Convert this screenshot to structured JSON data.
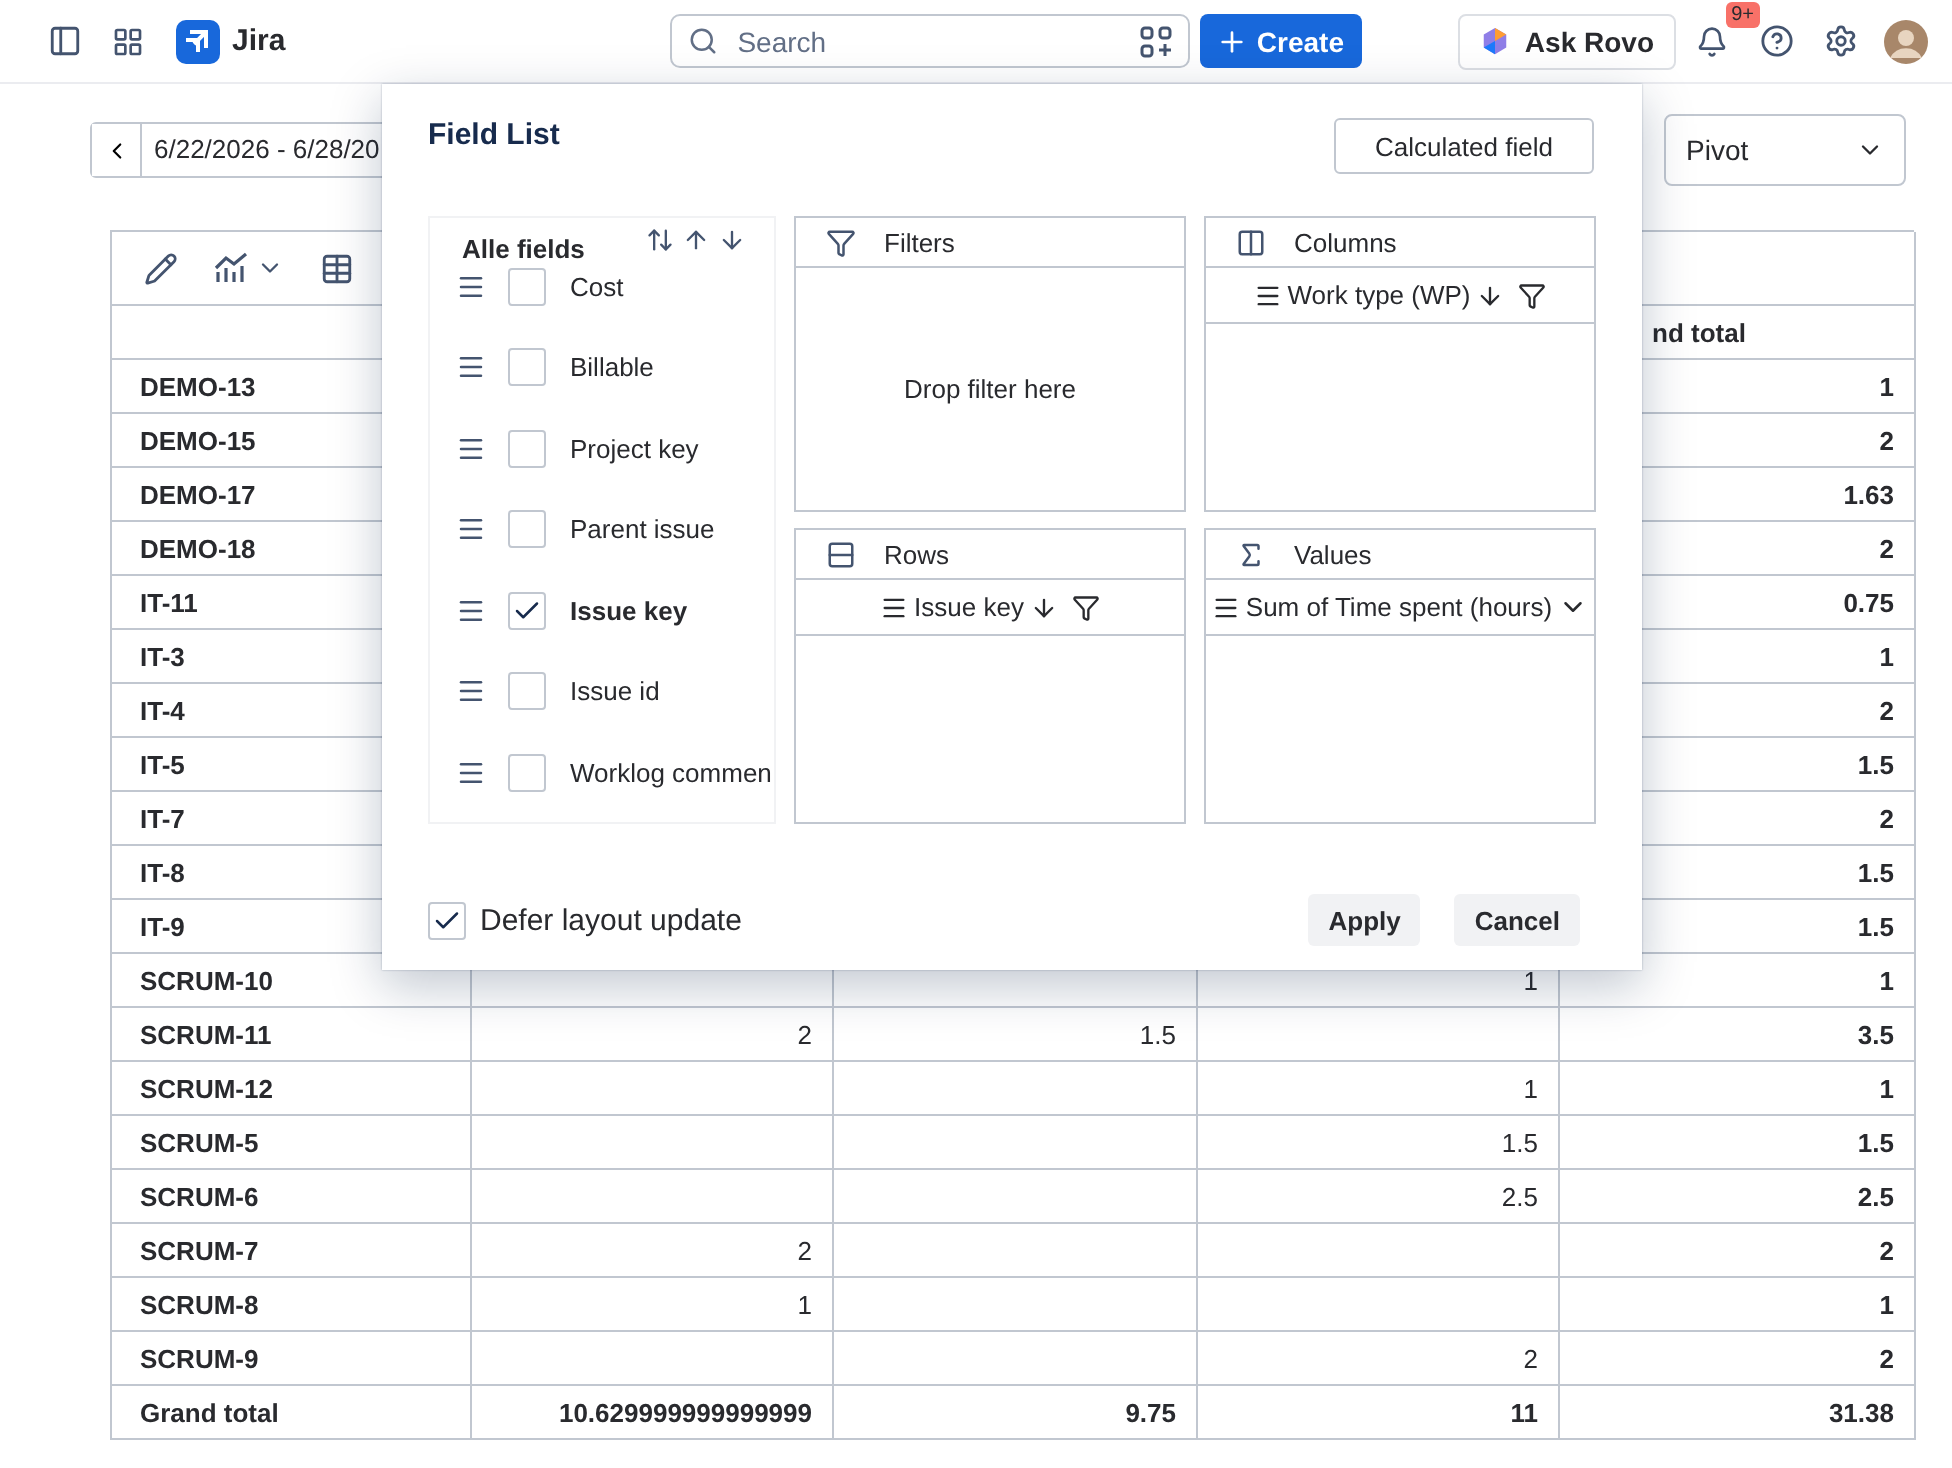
{
  "header": {
    "app_name": "Jira",
    "search_placeholder": "Search",
    "create_label": "Create",
    "ask_rovo": "Ask Rovo",
    "notification_badge": "9+"
  },
  "date_range": {
    "label": "6/22/2026 - 6/28/20"
  },
  "view_select": {
    "value": "Pivot"
  },
  "table": {
    "header_last": "nd total",
    "rows": [
      {
        "key": "DEMO-13",
        "cells": [
          null,
          null,
          null,
          "1"
        ]
      },
      {
        "key": "DEMO-15",
        "cells": [
          null,
          null,
          null,
          "2"
        ]
      },
      {
        "key": "DEMO-17",
        "cells": [
          null,
          null,
          null,
          "1.63"
        ]
      },
      {
        "key": "DEMO-18",
        "cells": [
          null,
          null,
          null,
          "2"
        ]
      },
      {
        "key": "IT-11",
        "cells": [
          null,
          null,
          null,
          "0.75"
        ]
      },
      {
        "key": "IT-3",
        "cells": [
          null,
          null,
          null,
          "1"
        ]
      },
      {
        "key": "IT-4",
        "cells": [
          null,
          null,
          null,
          "2"
        ]
      },
      {
        "key": "IT-5",
        "cells": [
          null,
          null,
          null,
          "1.5"
        ]
      },
      {
        "key": "IT-7",
        "cells": [
          null,
          null,
          null,
          "2"
        ]
      },
      {
        "key": "IT-8",
        "cells": [
          null,
          null,
          null,
          "1.5"
        ]
      },
      {
        "key": "IT-9",
        "cells": [
          null,
          null,
          null,
          "1.5"
        ]
      },
      {
        "key": "SCRUM-10",
        "cells": [
          null,
          null,
          "1",
          "1"
        ]
      },
      {
        "key": "SCRUM-11",
        "cells": [
          "2",
          "1.5",
          null,
          "3.5"
        ]
      },
      {
        "key": "SCRUM-12",
        "cells": [
          null,
          null,
          "1",
          "1"
        ]
      },
      {
        "key": "SCRUM-5",
        "cells": [
          null,
          null,
          "1.5",
          "1.5"
        ]
      },
      {
        "key": "SCRUM-6",
        "cells": [
          null,
          null,
          "2.5",
          "2.5"
        ]
      },
      {
        "key": "SCRUM-7",
        "cells": [
          "2",
          null,
          null,
          "2"
        ]
      },
      {
        "key": "SCRUM-8",
        "cells": [
          "1",
          null,
          null,
          "1"
        ]
      },
      {
        "key": "SCRUM-9",
        "cells": [
          null,
          null,
          "2",
          "2"
        ]
      }
    ],
    "total": {
      "key": "Grand total",
      "cells": [
        "10.629999999999999",
        "9.75",
        "11",
        "31.38"
      ]
    }
  },
  "modal": {
    "title": "Field List",
    "calculated_field": "Calculated field",
    "fields_title": "Alle fields",
    "fields": [
      {
        "label": "Cost",
        "checked": false
      },
      {
        "label": "Billable",
        "checked": false
      },
      {
        "label": "Project key",
        "checked": false
      },
      {
        "label": "Parent issue",
        "checked": false
      },
      {
        "label": "Issue key",
        "checked": true
      },
      {
        "label": "Issue id",
        "checked": false
      },
      {
        "label": "Worklog commen",
        "checked": false
      }
    ],
    "filters": {
      "title": "Filters",
      "placeholder": "Drop filter here"
    },
    "columns": {
      "title": "Columns",
      "items": [
        "Work type (WP)"
      ]
    },
    "rows": {
      "title": "Rows",
      "items": [
        "Issue key"
      ]
    },
    "values": {
      "title": "Values",
      "items": [
        "Sum of Time spent (hours)"
      ]
    },
    "defer": {
      "label": "Defer layout update",
      "checked": true
    },
    "apply": "Apply",
    "cancel": "Cancel"
  }
}
